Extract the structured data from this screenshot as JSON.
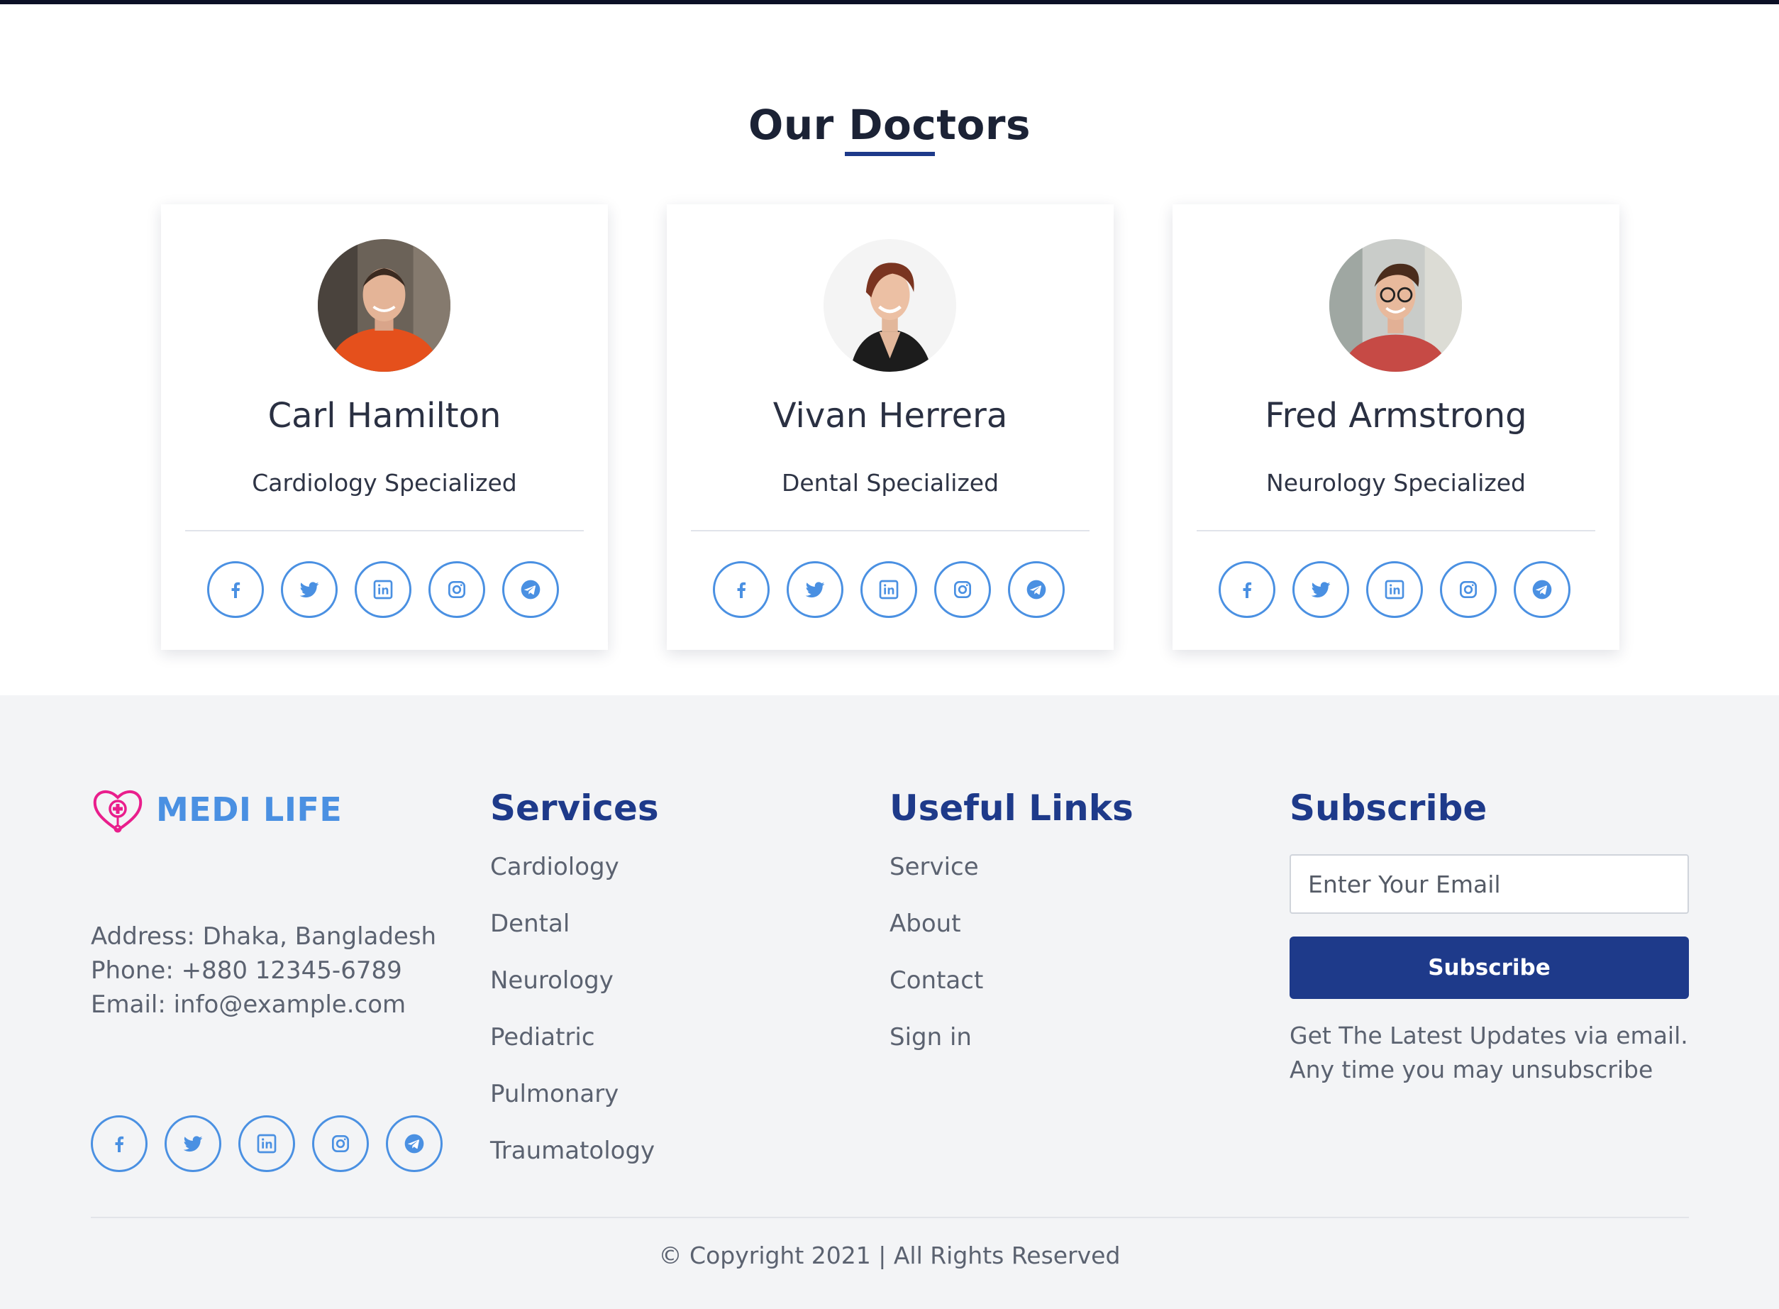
{
  "section": {
    "title": "Our Doctors"
  },
  "doctors": [
    {
      "name": "Carl Hamilton",
      "specialty": "Cardiology Specialized"
    },
    {
      "name": "Vivan Herrera",
      "specialty": "Dental Specialized"
    },
    {
      "name": "Fred Armstrong",
      "specialty": "Neurology Specialized"
    }
  ],
  "social_icons": [
    "facebook-icon",
    "twitter-icon",
    "linkedin-icon",
    "instagram-icon",
    "telegram-icon"
  ],
  "footer": {
    "brand": "MEDI LIFE",
    "address": "Address: Dhaka, Bangladesh",
    "phone": "Phone: +880 12345-6789",
    "email": "Email: info@example.com",
    "services_heading": "Services",
    "services": [
      "Cardiology",
      "Dental",
      "Neurology",
      "Pediatric",
      "Pulmonary",
      "Traumatology"
    ],
    "links_heading": "Useful Links",
    "links": [
      "Service",
      "About",
      "Contact",
      "Sign in"
    ],
    "subscribe_heading": "Subscribe",
    "email_placeholder": "Enter Your Email",
    "subscribe_button": "Subscribe",
    "subscribe_note_1": "Get The Latest Updates via email.",
    "subscribe_note_2": "Any time you may unsubscribe",
    "copyright": "© Copyright 2021 | All Rights Reserved"
  },
  "colors": {
    "primary": "#1e3a8a",
    "accent": "#4a90e2",
    "logo_pink": "#e91e8c",
    "footer_bg": "#f3f4f6"
  }
}
